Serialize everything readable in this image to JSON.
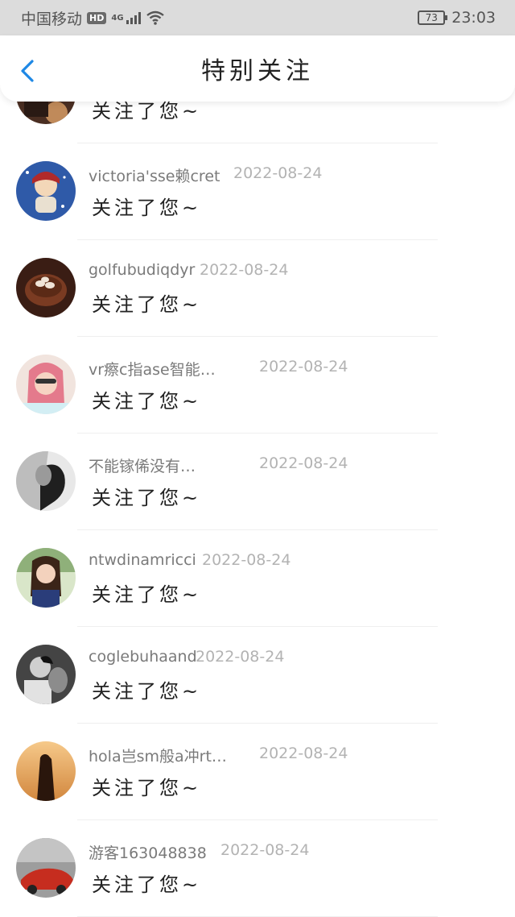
{
  "status_bar": {
    "carrier": "中国移动",
    "hd_badge": "HD",
    "network": "4G",
    "battery": "73",
    "time": "23:03"
  },
  "nav": {
    "title": "特别关注",
    "back_icon": "chevron-left-icon"
  },
  "colors": {
    "accent": "#1e88e5",
    "date_text": "#b3b3b3",
    "name_text": "#7a7a7a"
  },
  "items": [
    {
      "name": "",
      "date": "",
      "action": "关注了您~"
    },
    {
      "name": "victoria'sse赖cret",
      "date": "2022-08-24",
      "action": "关注了您~"
    },
    {
      "name": "golfubudiqdyr",
      "date": "2022-08-24",
      "action": "关注了您~"
    },
    {
      "name": "vr瘵c指ase智能…",
      "date": "2022-08-24",
      "action": "关注了您~"
    },
    {
      "name": "不能镓俙没有…",
      "date": "2022-08-24",
      "action": "关注了您~"
    },
    {
      "name": "ntwdinamricci",
      "date": "2022-08-24",
      "action": "关注了您~"
    },
    {
      "name": "coglebuhaand",
      "date": "2022-08-24",
      "action": "关注了您~"
    },
    {
      "name": "hola岂sm般a冲rt…",
      "date": "2022-08-24",
      "action": "关注了您~"
    },
    {
      "name": "游客163048838",
      "date": "2022-08-24",
      "action": "关注了您~"
    }
  ]
}
